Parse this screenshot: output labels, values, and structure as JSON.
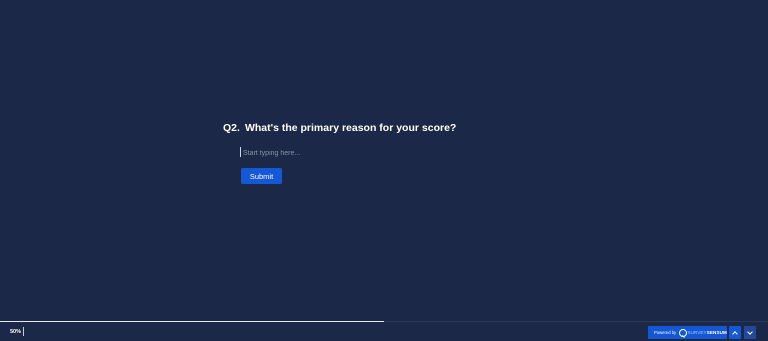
{
  "question": {
    "number": "Q2.",
    "text": "What's the primary reason for your score?"
  },
  "answer": {
    "value": "",
    "placeholder": "Start typing here..."
  },
  "submit": {
    "label": "Submit"
  },
  "footer": {
    "progress_text": "50%",
    "progress_fraction": 0.5,
    "powered_by_label": "Powered by",
    "brand_part1": "SURVEY",
    "brand_part2": "SENSUM",
    "up_icon": "chevron-up-icon",
    "down_icon": "chevron-down-icon"
  },
  "colors": {
    "background": "#1b2847",
    "accent": "#1558d6",
    "text": "#ffffff"
  }
}
